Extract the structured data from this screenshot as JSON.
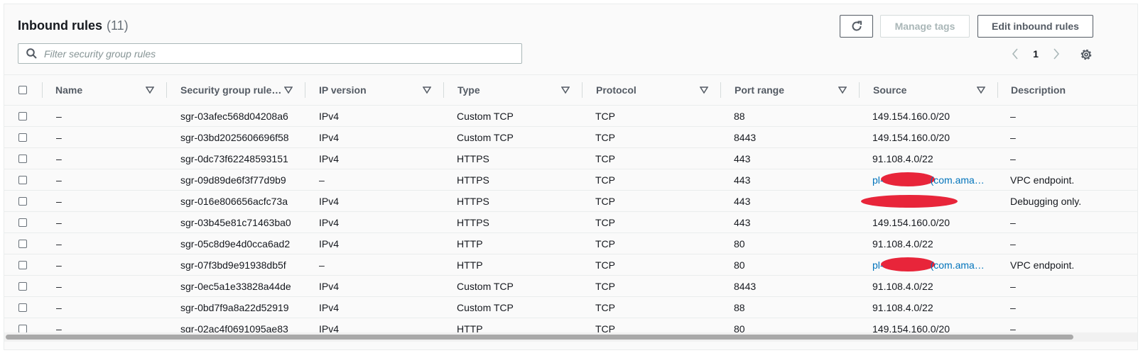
{
  "header": {
    "title": "Inbound rules",
    "count": "(11)",
    "manage_tags_label": "Manage tags",
    "edit_label": "Edit inbound rules"
  },
  "search": {
    "placeholder": "Filter security group rules",
    "value": ""
  },
  "pagination": {
    "current_page": "1"
  },
  "columns": [
    "Name",
    "Security group rule…",
    "IP version",
    "Type",
    "Protocol",
    "Port range",
    "Source",
    "Description"
  ],
  "rows": [
    {
      "name": "–",
      "rule_id": "sgr-03afec568d04208a6",
      "ip_version": "IPv4",
      "type": "Custom TCP",
      "protocol": "TCP",
      "port": "88",
      "source": "149.154.160.0/20",
      "source_kind": "cidr",
      "description": "–"
    },
    {
      "name": "–",
      "rule_id": "sgr-03bd2025606696f58",
      "ip_version": "IPv4",
      "type": "Custom TCP",
      "protocol": "TCP",
      "port": "8443",
      "source": "149.154.160.0/20",
      "source_kind": "cidr",
      "description": "–"
    },
    {
      "name": "–",
      "rule_id": "sgr-0dc73f62248593151",
      "ip_version": "IPv4",
      "type": "HTTPS",
      "protocol": "TCP",
      "port": "443",
      "source": "91.108.4.0/22",
      "source_kind": "cidr",
      "description": "–"
    },
    {
      "name": "–",
      "rule_id": "sgr-09d89de6f3f77d9b9",
      "ip_version": "–",
      "type": "HTTPS",
      "protocol": "TCP",
      "port": "443",
      "source_prefix": "pl-",
      "source_suffix": "(com.ama…",
      "source_kind": "prefix-list",
      "description": "VPC endpoint."
    },
    {
      "name": "–",
      "rule_id": "sgr-016e806656acfc73a",
      "ip_version": "IPv4",
      "type": "HTTPS",
      "protocol": "TCP",
      "port": "443",
      "source": "",
      "source_kind": "redacted",
      "description": "Debugging only."
    },
    {
      "name": "–",
      "rule_id": "sgr-03b45e81c71463ba0",
      "ip_version": "IPv4",
      "type": "HTTPS",
      "protocol": "TCP",
      "port": "443",
      "source": "149.154.160.0/20",
      "source_kind": "cidr",
      "description": "–"
    },
    {
      "name": "–",
      "rule_id": "sgr-05c8d9e4d0cca6ad2",
      "ip_version": "IPv4",
      "type": "HTTP",
      "protocol": "TCP",
      "port": "80",
      "source": "91.108.4.0/22",
      "source_kind": "cidr",
      "description": "–"
    },
    {
      "name": "–",
      "rule_id": "sgr-07f3bd9e91938db5f",
      "ip_version": "–",
      "type": "HTTP",
      "protocol": "TCP",
      "port": "80",
      "source_prefix": "pl-",
      "source_suffix": "(com.ama…",
      "source_kind": "prefix-list",
      "description": "VPC endpoint."
    },
    {
      "name": "–",
      "rule_id": "sgr-0ec5a1e33828a44de",
      "ip_version": "IPv4",
      "type": "Custom TCP",
      "protocol": "TCP",
      "port": "8443",
      "source": "91.108.4.0/22",
      "source_kind": "cidr",
      "description": "–"
    },
    {
      "name": "–",
      "rule_id": "sgr-0bd7f9a8a22d52919",
      "ip_version": "IPv4",
      "type": "Custom TCP",
      "protocol": "TCP",
      "port": "88",
      "source": "91.108.4.0/22",
      "source_kind": "cidr",
      "description": "–"
    },
    {
      "name": "–",
      "rule_id": "sgr-02ac4f0691095ae83",
      "ip_version": "IPv4",
      "type": "HTTP",
      "protocol": "TCP",
      "port": "80",
      "source": "149.154.160.0/20",
      "source_kind": "cidr",
      "description": "–"
    }
  ],
  "icons": {
    "refresh": "refresh-icon",
    "search": "search-icon",
    "prev": "chevron-left-icon",
    "next": "chevron-right-icon",
    "settings": "gear-icon",
    "sort": "caret-down-icon"
  },
  "colors": {
    "link": "#0073bb",
    "redaction": "#e8253a",
    "text": "#16191f"
  }
}
